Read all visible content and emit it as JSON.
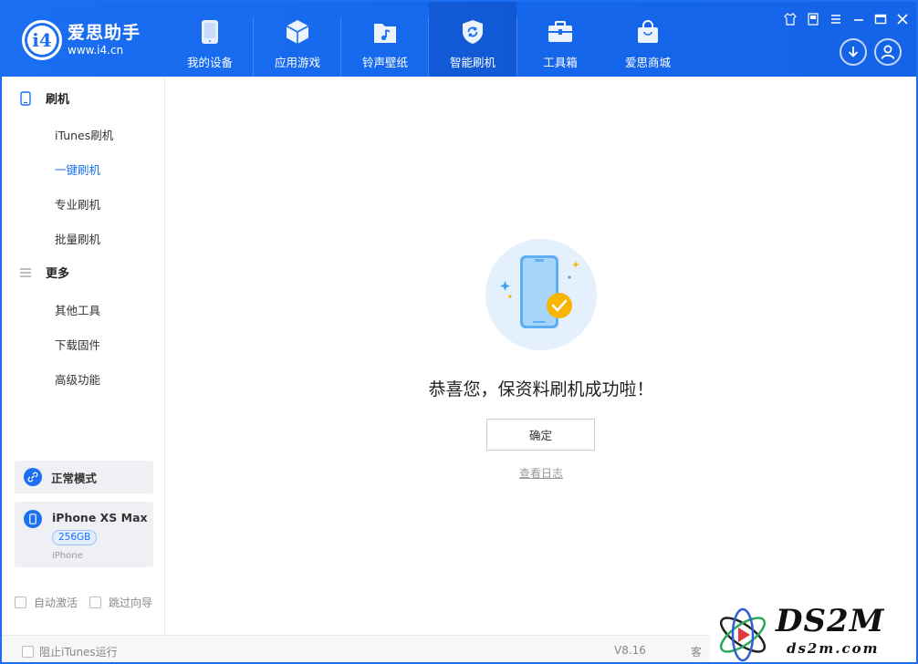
{
  "app": {
    "name": "爱思助手",
    "url": "www.i4.cn",
    "logo_text": "i4"
  },
  "nav": [
    {
      "label": "我的设备",
      "icon": "phone-icon"
    },
    {
      "label": "应用游戏",
      "icon": "cube-icon"
    },
    {
      "label": "铃声壁纸",
      "icon": "music-folder-icon"
    },
    {
      "label": "智能刷机",
      "icon": "refresh-shield-icon",
      "active": true
    },
    {
      "label": "工具箱",
      "icon": "toolbox-icon"
    },
    {
      "label": "爱思商城",
      "icon": "shopping-bag-icon"
    }
  ],
  "sidebar": {
    "flash_title": "刷机",
    "flash_items": [
      "iTunes刷机",
      "一键刷机",
      "专业刷机",
      "批量刷机"
    ],
    "active_item": "一键刷机",
    "more_title": "更多",
    "more_items": [
      "其他工具",
      "下载固件",
      "高级功能"
    ],
    "mode_label": "正常模式",
    "device": {
      "name": "iPhone XS Max",
      "storage": "256GB",
      "type": "iPhone"
    },
    "auto_activate": "自动激活",
    "skip_guide": "跳过向导"
  },
  "main": {
    "message": "恭喜您，保资料刷机成功啦！",
    "confirm_label": "确定",
    "view_log": "查看日志"
  },
  "footer": {
    "block_itunes": "阻止iTunes运行",
    "version": "V8.16",
    "partial_text": "客"
  },
  "watermark": {
    "brand": "DS2M",
    "domain": "ds2m.com"
  },
  "colors": {
    "accent": "#1b6ff0",
    "success": "#f5b800",
    "illustration_bg": "#e4f1fc"
  }
}
